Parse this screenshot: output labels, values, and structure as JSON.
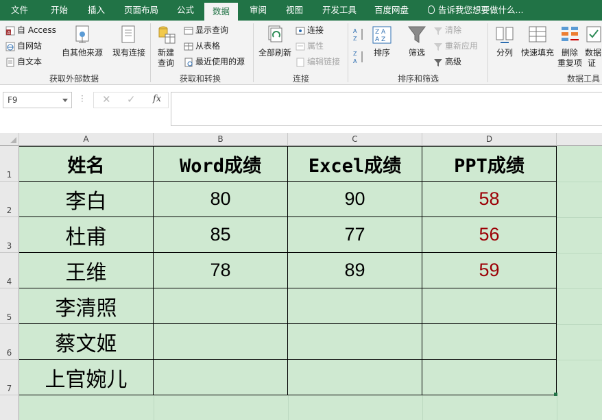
{
  "tabs": [
    {
      "label": "文件",
      "active": false
    },
    {
      "label": "开始",
      "active": false
    },
    {
      "label": "插入",
      "active": false
    },
    {
      "label": "页面布局",
      "active": false
    },
    {
      "label": "公式",
      "active": false
    },
    {
      "label": "数据",
      "active": true
    },
    {
      "label": "审阅",
      "active": false
    },
    {
      "label": "视图",
      "active": false
    },
    {
      "label": "开发工具",
      "active": false
    },
    {
      "label": "百度网盘",
      "active": false
    }
  ],
  "tell_me": "告诉我您想要做什么...",
  "ribbon": {
    "get_external": {
      "access": "自 Access",
      "web": "自网站",
      "text": "自文本",
      "other": "自其他来源",
      "existing": "现有连接",
      "label": "获取外部数据"
    },
    "get_transform": {
      "new_query_1": "新建",
      "new_query_2": "查询",
      "show_queries": "显示查询",
      "from_table": "从表格",
      "recent_sources": "最近使用的源",
      "label": "获取和转换"
    },
    "connections": {
      "refresh_all": "全部刷新",
      "connections": "连接",
      "properties": "属性",
      "edit_links": "编辑链接",
      "label": "连接"
    },
    "sort_filter": {
      "sort": "排序",
      "filter": "筛选",
      "clear": "清除",
      "reapply": "重新应用",
      "advanced": "高级",
      "label": "排序和筛选"
    },
    "data_tools": {
      "split": "分列",
      "flash_fill": "快速填充",
      "remove_dup_1": "删除",
      "remove_dup_2": "重复项",
      "validation_1": "数据",
      "validation_2": "证",
      "label": "数据工具"
    }
  },
  "formula_bar": {
    "name_box": "F9",
    "fx": "fx"
  },
  "columns": [
    "A",
    "B",
    "C",
    "D"
  ],
  "rows": [
    "1",
    "2",
    "3",
    "4",
    "5",
    "6",
    "7"
  ],
  "table": {
    "headers": [
      "姓名",
      "Word成绩",
      "Excel成绩",
      "PPT成绩"
    ],
    "records": [
      {
        "name": "李白",
        "word": "80",
        "excel": "90",
        "ppt": "58"
      },
      {
        "name": "杜甫",
        "word": "85",
        "excel": "77",
        "ppt": "56"
      },
      {
        "name": "王维",
        "word": "78",
        "excel": "89",
        "ppt": "59"
      },
      {
        "name": "李清照",
        "word": "",
        "excel": "",
        "ppt": ""
      },
      {
        "name": "蔡文姬",
        "word": "",
        "excel": "",
        "ppt": ""
      },
      {
        "name": "上官婉儿",
        "word": "",
        "excel": "",
        "ppt": ""
      }
    ]
  },
  "colors": {
    "brand": "#217346",
    "sheet_fill": "#cfe9d1",
    "low_score": "#9c0006"
  }
}
